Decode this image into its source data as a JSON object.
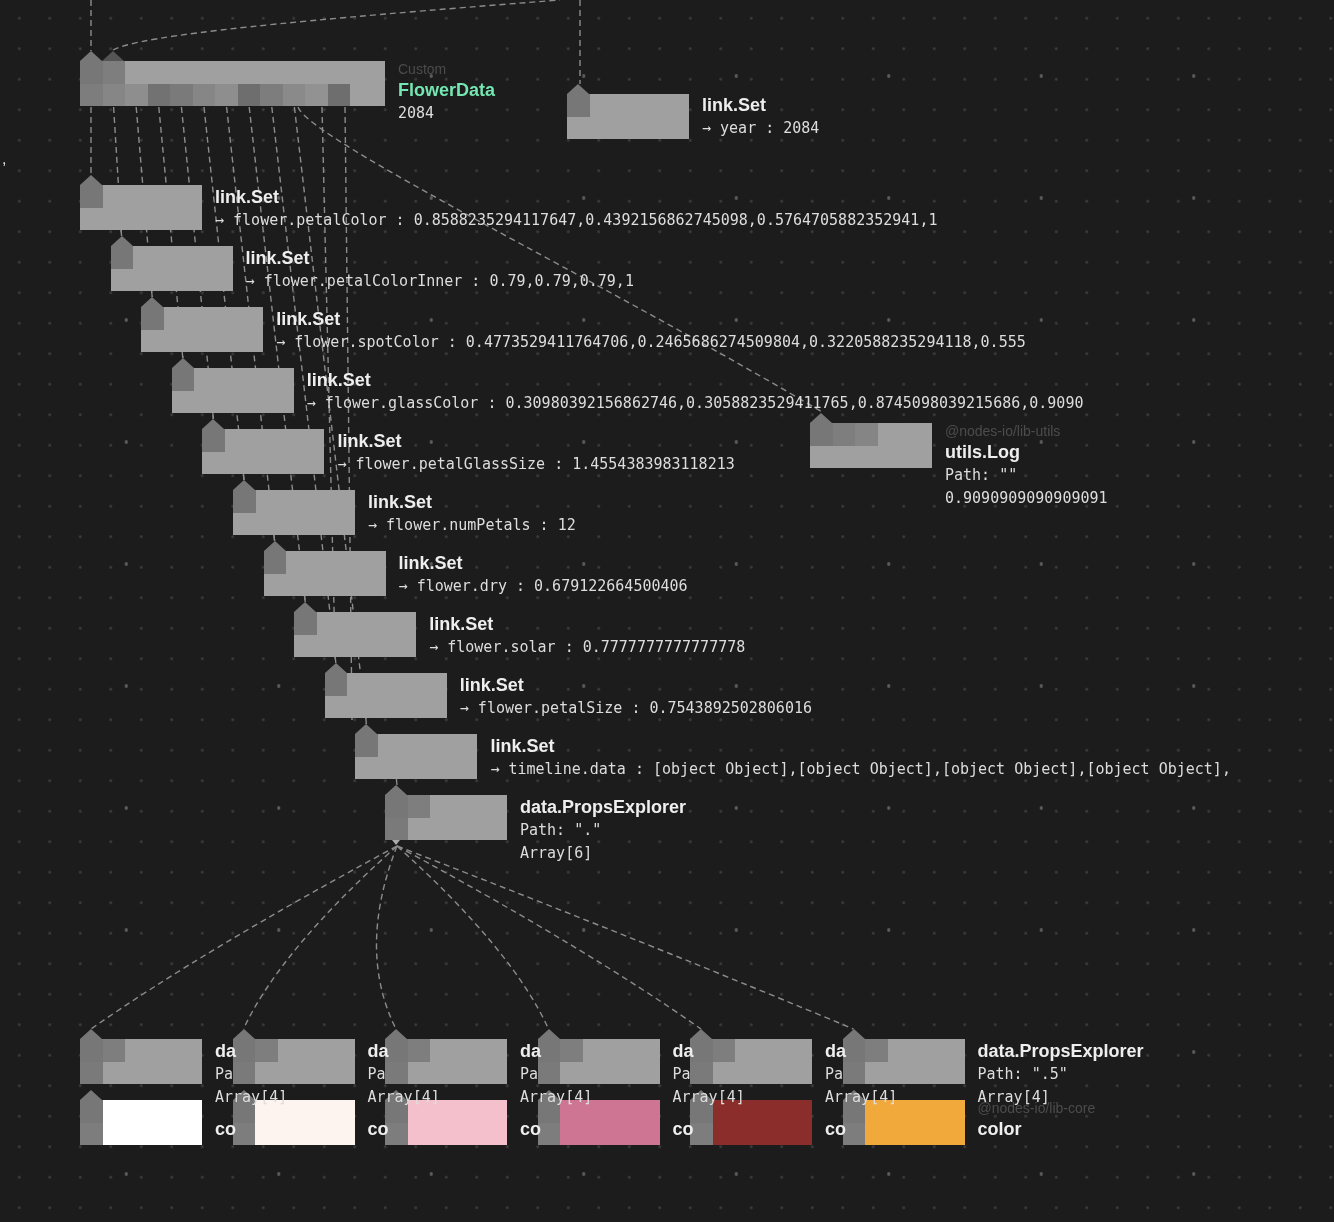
{
  "edge_text": ",",
  "custom_node": {
    "package": "Custom",
    "title": "FlowerData",
    "value": "2084"
  },
  "year_setter": {
    "title": "link.Set",
    "line": "→ year : 2084"
  },
  "setters": [
    {
      "title": "link.Set",
      "line": "→ flower.petalColor : 0.8588235294117647,0.4392156862745098,0.5764705882352941,1"
    },
    {
      "title": "link.Set",
      "line": "→ flower.petalColorInner : 0.79,0.79,0.79,1"
    },
    {
      "title": "link.Set",
      "line": "→ flower.spotColor : 0.4773529411764706,0.2465686274509804,0.3220588235294118,0.555"
    },
    {
      "title": "link.Set",
      "line": "→ flower.glassColor : 0.30980392156862746,0.3058823529411765,0.8745098039215686,0.9090"
    },
    {
      "title": "link.Set",
      "line": "→ flower.petalGlassSize : 1.4554383983118213"
    },
    {
      "title": "link.Set",
      "line": "→ flower.numPetals : 12"
    },
    {
      "title": "link.Set",
      "line": "→ flower.dry : 0.679122664500406"
    },
    {
      "title": "link.Set",
      "line": "→ flower.solar : 0.7777777777777778"
    },
    {
      "title": "link.Set",
      "line": "→ flower.petalSize : 0.7543892502806016"
    },
    {
      "title": "link.Set",
      "line": "→ timeline.data : [object Object],[object Object],[object Object],[object Object],"
    }
  ],
  "log_node": {
    "package": "@nodes-io/lib-utils",
    "title": "utils.Log",
    "path": "Path: \"\"",
    "value": "0.9090909090909091"
  },
  "explorer": {
    "title": "data.PropsExplorer",
    "path": "Path: \".\"",
    "value": "Array[6]"
  },
  "children": [
    {
      "title": "da",
      "path": "Pa",
      "value": "Array[4]",
      "color_title": "co",
      "color": "#ffffff"
    },
    {
      "title": "da",
      "path": "Pa",
      "value": "Array[4]",
      "color_title": "co",
      "color": "#fdf3ef"
    },
    {
      "title": "da",
      "path": "Pa",
      "value": "Array[4]",
      "color_title": "co",
      "color": "#f4c0cb"
    },
    {
      "title": "da",
      "path": "Pa",
      "value": "Array[4]",
      "color_title": "co",
      "color": "#cf7594"
    },
    {
      "title": "da",
      "path": "Pa",
      "value": "Array[4]",
      "color_title": "co",
      "color": "#8b2e2b"
    },
    {
      "title": "data.PropsExplorer",
      "path": "Path: \".5\"",
      "value": "Array[4]",
      "package": "@nodes-io/lib-core",
      "color_title": "color",
      "color": "#f0a93a"
    }
  ]
}
